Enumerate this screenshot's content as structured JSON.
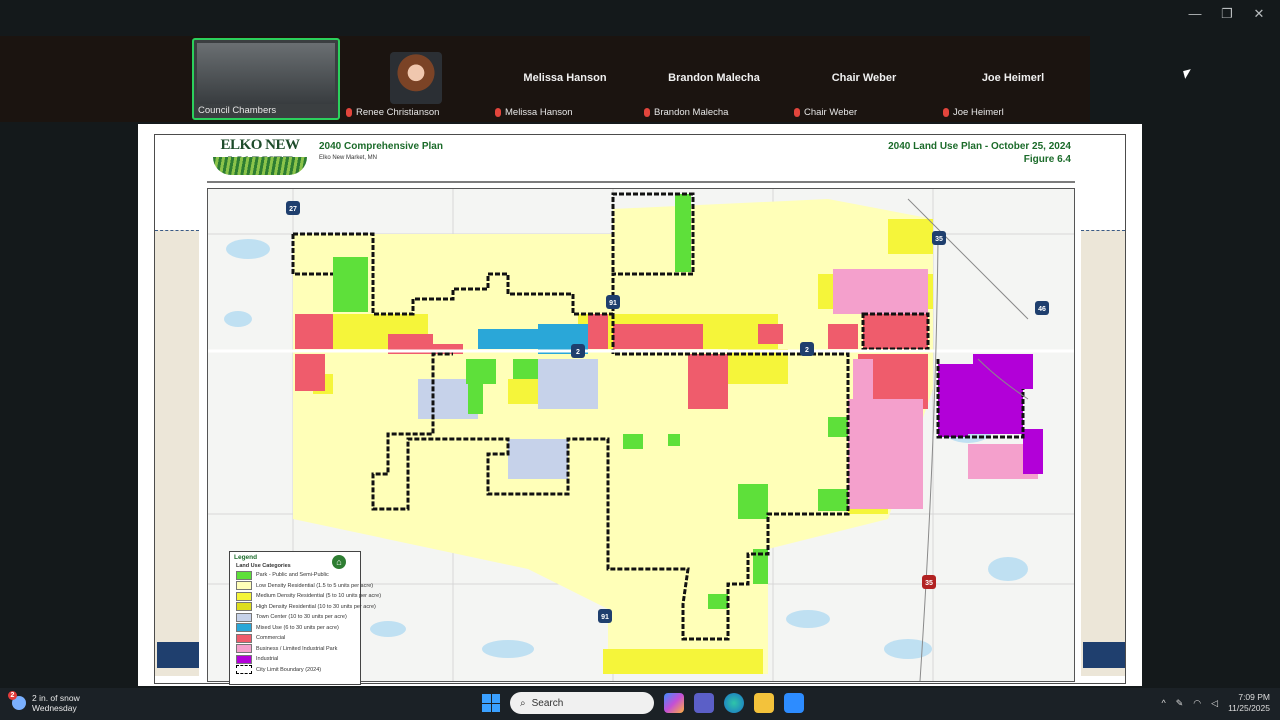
{
  "window": {
    "minimize": "—",
    "maximize": "❐",
    "close": "✕"
  },
  "participants": [
    {
      "label": "Council Chambers",
      "type": "video"
    },
    {
      "label": "Renee Christianson",
      "type": "photo"
    },
    {
      "name": "Melissa Hanson",
      "label": "Melissa Hanson",
      "type": "name"
    },
    {
      "name": "Brandon Malecha",
      "label": "Brandon Malecha",
      "type": "name"
    },
    {
      "name": "Chair Weber",
      "label": "Chair Weber",
      "type": "name"
    },
    {
      "name": "Joe Heimerl",
      "label": "Joe Heimerl",
      "type": "name"
    }
  ],
  "slide": {
    "logo_text": "ELKO NEW MARKET",
    "plan_title": "2040 Comprehensive Plan",
    "plan_location": "Elko New Market, MN",
    "map_title": "2040 Land Use Plan - October 25, 2024",
    "figure": "Figure 6.4",
    "road_labels": [
      "27",
      "91",
      "2",
      "2",
      "46",
      "35",
      "91"
    ],
    "legend": {
      "title": "Legend",
      "category_title": "Land Use Categories",
      "items": [
        {
          "label": "Park - Public and Semi-Public",
          "color": "#5ee03a"
        },
        {
          "label": "Low Density Residential (1.5 to 5 units per acre)",
          "color": "#ffffb8"
        },
        {
          "label": "Medium Density Residential (5 to 10 units per acre)",
          "color": "#f5f53a"
        },
        {
          "label": "High Density Residential (10 to 30 units per acre)",
          "color": "#dede1e"
        },
        {
          "label": "Town Center (10 to 30 units per acre)",
          "color": "#c6d2ea"
        },
        {
          "label": "Mixed Use (6 to 30 units per acre)",
          "color": "#2aa7d8"
        },
        {
          "label": "Commercial",
          "color": "#ef5c6c"
        },
        {
          "label": "Business / Limited Industrial Park",
          "color": "#f4a0cc"
        },
        {
          "label": "Industrial",
          "color": "#b200d8"
        },
        {
          "label": "City Limit Boundary (2024)",
          "color": "#000000"
        }
      ]
    }
  },
  "taskbar": {
    "weather_line1": "2 in. of snow",
    "weather_line2": "Wednesday",
    "weather_badge": "2",
    "search_placeholder": "Search",
    "time": "7:09 PM",
    "date": "11/25/2025"
  },
  "colors": {
    "park": "#5ee03a",
    "low": "#ffffb8",
    "medium": "#f5f53a",
    "commercial": "#ef5c6c",
    "business": "#f4a0cc",
    "industrial": "#b200d8",
    "mixed": "#2aa7d8",
    "town": "#c6d2ea"
  }
}
